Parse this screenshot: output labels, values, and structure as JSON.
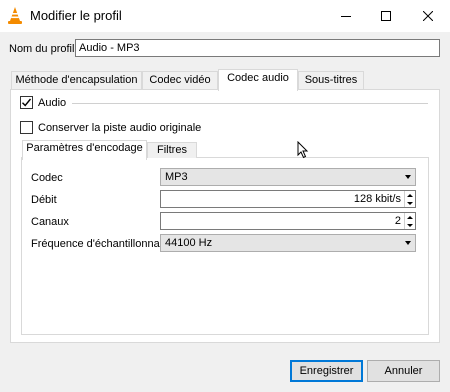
{
  "window": {
    "title": "Modifier le profil"
  },
  "profile": {
    "label": "Nom du profil",
    "value": "Audio - MP3"
  },
  "tabs": [
    {
      "label": "Méthode d'encapsulation"
    },
    {
      "label": "Codec vidéo"
    },
    {
      "label": "Codec audio"
    },
    {
      "label": "Sous-titres"
    }
  ],
  "audio_checkbox": {
    "label": "Audio",
    "checked": true
  },
  "keep_track_checkbox": {
    "label": "Conserver la piste audio originale",
    "checked": false
  },
  "inner_tabs": [
    {
      "label": "Paramètres d'encodage"
    },
    {
      "label": "Filtres"
    }
  ],
  "form": {
    "codec": {
      "label": "Codec",
      "value": "MP3"
    },
    "bitrate": {
      "label": "Débit",
      "value": "128 kbit/s"
    },
    "channels": {
      "label": "Canaux",
      "value": "2"
    },
    "samplerate": {
      "label": "Fréquence d'échantillonnage",
      "value": "44100 Hz"
    }
  },
  "buttons": {
    "save": "Enregistrer",
    "cancel": "Annuler"
  },
  "colors": {
    "accent": "#0078d7",
    "vlc_orange": "#f48b00"
  }
}
